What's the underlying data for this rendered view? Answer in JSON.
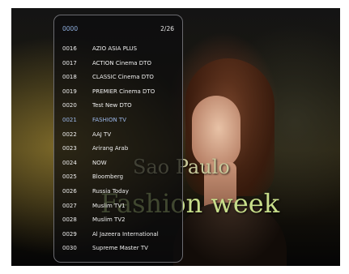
{
  "overlay": {
    "current_number": "0000",
    "page_indicator": "2/26",
    "selected_index": 5,
    "channels": [
      {
        "number": "0016",
        "name": "AZIO ASIA PLUS"
      },
      {
        "number": "0017",
        "name": "ACTION Cinema DTO"
      },
      {
        "number": "0018",
        "name": "CLASSIC Cinema DTO"
      },
      {
        "number": "0019",
        "name": "PREMIER Cinema DTO"
      },
      {
        "number": "0020",
        "name": "Test New DTO"
      },
      {
        "number": "0021",
        "name": "FASHION TV"
      },
      {
        "number": "0022",
        "name": "AAJ TV"
      },
      {
        "number": "0023",
        "name": "Arirang Arab"
      },
      {
        "number": "0024",
        "name": "NOW"
      },
      {
        "number": "0025",
        "name": "Bloomberg"
      },
      {
        "number": "0026",
        "name": "Russia Today"
      },
      {
        "number": "0027",
        "name": "Muslim TV1"
      },
      {
        "number": "0028",
        "name": "Muslim TV2"
      },
      {
        "number": "0029",
        "name": "Al Jazeera International"
      },
      {
        "number": "0030",
        "name": "Supreme Master TV"
      }
    ]
  },
  "video": {
    "caption_line1": "Sao Paulo",
    "caption_line2": "Fashion week"
  },
  "colors": {
    "selected_text": "#9cb8ea",
    "normal_text": "#f0f0f0",
    "panel_border": "#6b6b70"
  }
}
